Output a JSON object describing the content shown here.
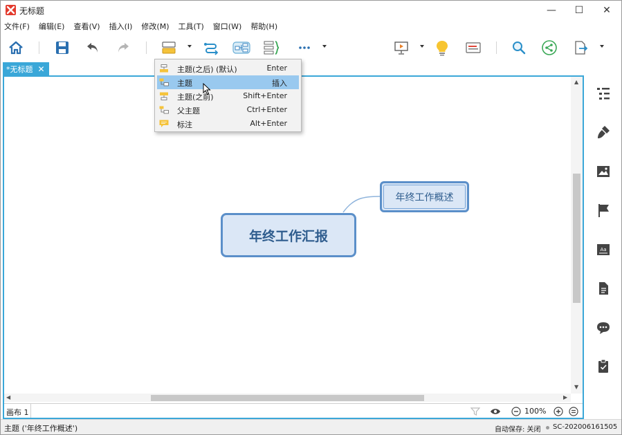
{
  "window": {
    "title": "无标题",
    "minimize": "—",
    "maximize": "☐",
    "close": "✕"
  },
  "menu": [
    "文件(F)",
    "编辑(E)",
    "查看(V)",
    "插入(I)",
    "修改(M)",
    "工具(T)",
    "窗口(W)",
    "帮助(H)"
  ],
  "tab": {
    "label": "*无标题",
    "close": "✕"
  },
  "dropdown": {
    "items": [
      {
        "label": "主题(之后) (默认)",
        "shortcut": "Enter"
      },
      {
        "label": "主题",
        "shortcut": "插入"
      },
      {
        "label": "主题(之前)",
        "shortcut": "Shift+Enter"
      },
      {
        "label": "父主题",
        "shortcut": "Ctrl+Enter"
      },
      {
        "label": "标注",
        "shortcut": "Alt+Enter"
      }
    ],
    "selected_index": 1
  },
  "canvas": {
    "central_topic": "年终工作汇报",
    "sub_topic": "年终工作概述",
    "sheet_label": "画布 1",
    "zoom": "100%"
  },
  "status": {
    "left": "主题 ('年终工作概述')",
    "autosave": "自动保存: 关闭",
    "machine": "SC-202006161505"
  },
  "colors": {
    "accent": "#3aa7d8",
    "topic_border": "#5b8fc9",
    "topic_fill": "#dbe7f6",
    "topic_text": "#2f5d8e",
    "menu_selected": "#99c9ef",
    "logo": "#e33b2e"
  }
}
